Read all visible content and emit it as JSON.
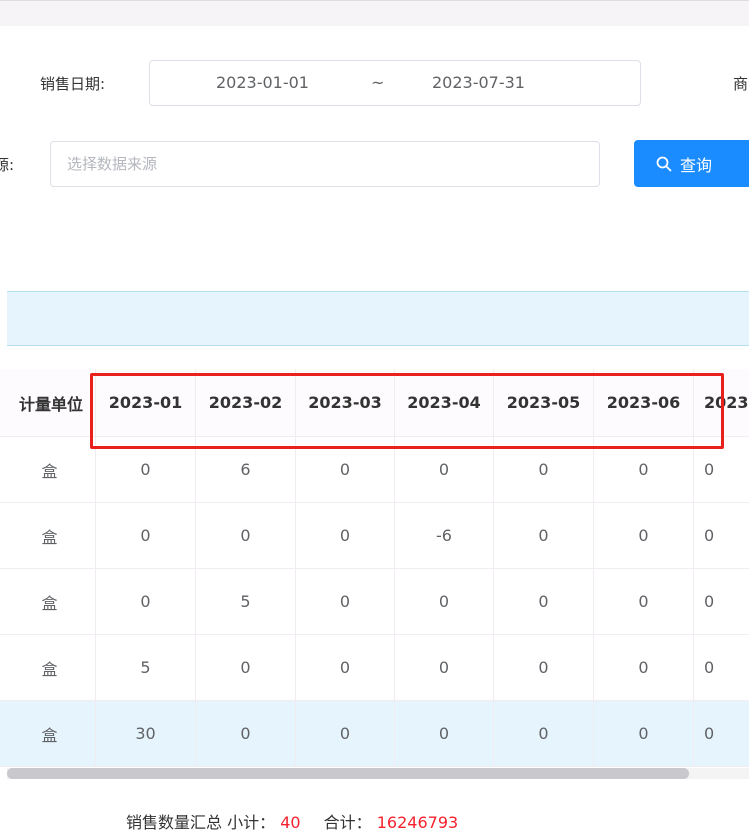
{
  "filters": {
    "sale_date_label": "销售日期:",
    "date_start": "2023-01-01",
    "date_separator": "~",
    "date_end": "2023-07-31",
    "cut_label_right": "商",
    "source_label": "源:",
    "source_placeholder": "选择数据来源",
    "query_button": "查询"
  },
  "table": {
    "columns": [
      "计量单位",
      "2023-01",
      "2023-02",
      "2023-03",
      "2023-04",
      "2023-05",
      "2023-06",
      "2023"
    ],
    "rows": [
      [
        "盒",
        "0",
        "6",
        "0",
        "0",
        "0",
        "0",
        "0"
      ],
      [
        "盒",
        "0",
        "0",
        "0",
        "-6",
        "0",
        "0",
        "0"
      ],
      [
        "盒",
        "0",
        "5",
        "0",
        "0",
        "0",
        "0",
        "0"
      ],
      [
        "盒",
        "5",
        "0",
        "0",
        "0",
        "0",
        "0",
        "0"
      ],
      [
        "盒",
        "30",
        "0",
        "0",
        "0",
        "0",
        "0",
        "0"
      ]
    ]
  },
  "summary": {
    "label": "销售数量汇总 小计：",
    "subtotal": "40",
    "total_label": "合计：",
    "total": "16246793"
  },
  "colors": {
    "primary": "#1a8cff",
    "highlight": "#e8211d",
    "summary_number": "#f5222d"
  }
}
